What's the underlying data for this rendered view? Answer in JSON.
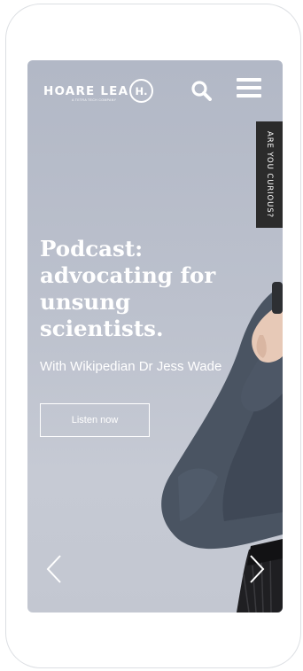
{
  "header": {
    "logo_text": "HOARE LEA",
    "logo_subtext": "A TETRA TECH COMPANY",
    "logo_mark": "H."
  },
  "side_tab": {
    "label": "ARE YOU CURIOUS?"
  },
  "hero": {
    "title": "Podcast: advocating for unsung scientists.",
    "subtitle": "With Wikipedian Dr Jess Wade",
    "cta_label": "Listen now"
  },
  "icons": {
    "search": "search-icon",
    "menu": "hamburger-menu-icon",
    "prev": "chevron-left-icon",
    "next": "chevron-right-icon"
  },
  "colors": {
    "hero_background": "#bcc1cd",
    "side_tab_background": "#2b2b2b",
    "text": "#ffffff"
  }
}
